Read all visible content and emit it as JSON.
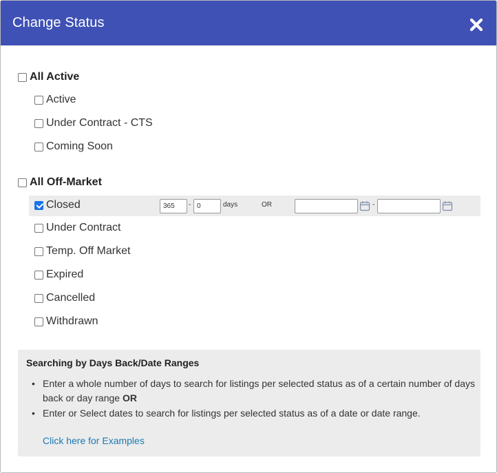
{
  "dialog": {
    "title": "Change Status",
    "close_icon": "close-icon"
  },
  "active_group": {
    "label": "All Active",
    "checked": false,
    "items": [
      {
        "label": "Active",
        "checked": false
      },
      {
        "label": "Under Contract - CTS",
        "checked": false
      },
      {
        "label": "Coming Soon",
        "checked": false
      }
    ]
  },
  "offmarket_group": {
    "label": "All Off-Market",
    "checked": false,
    "items": [
      {
        "label": "Closed",
        "checked": true
      },
      {
        "label": "Under Contract",
        "checked": false
      },
      {
        "label": "Temp. Off Market",
        "checked": false
      },
      {
        "label": "Expired",
        "checked": false
      },
      {
        "label": "Cancelled",
        "checked": false
      },
      {
        "label": "Withdrawn",
        "checked": false
      }
    ]
  },
  "closed_range": {
    "days_from": "365",
    "dash": "-",
    "days_to": "0",
    "days_label": "days",
    "or_label": "OR",
    "date_from": "",
    "date_to": "",
    "calendar_icon": "calendar-icon"
  },
  "info": {
    "title": "Searching by Days Back/Date Ranges",
    "bullet1": "Enter a whole number of days to search for listings per selected status as of a certain number of days back or day range",
    "bullet1_bold": "OR",
    "bullet2": "Enter or Select dates to search for listings per selected status as of a date or date range.",
    "bullet_char": "•",
    "link": "Click here for Examples"
  },
  "colors": {
    "header": "#3f51b5",
    "checked": "#1a73e8",
    "link": "#1a7ab5",
    "panel": "#ececec"
  }
}
